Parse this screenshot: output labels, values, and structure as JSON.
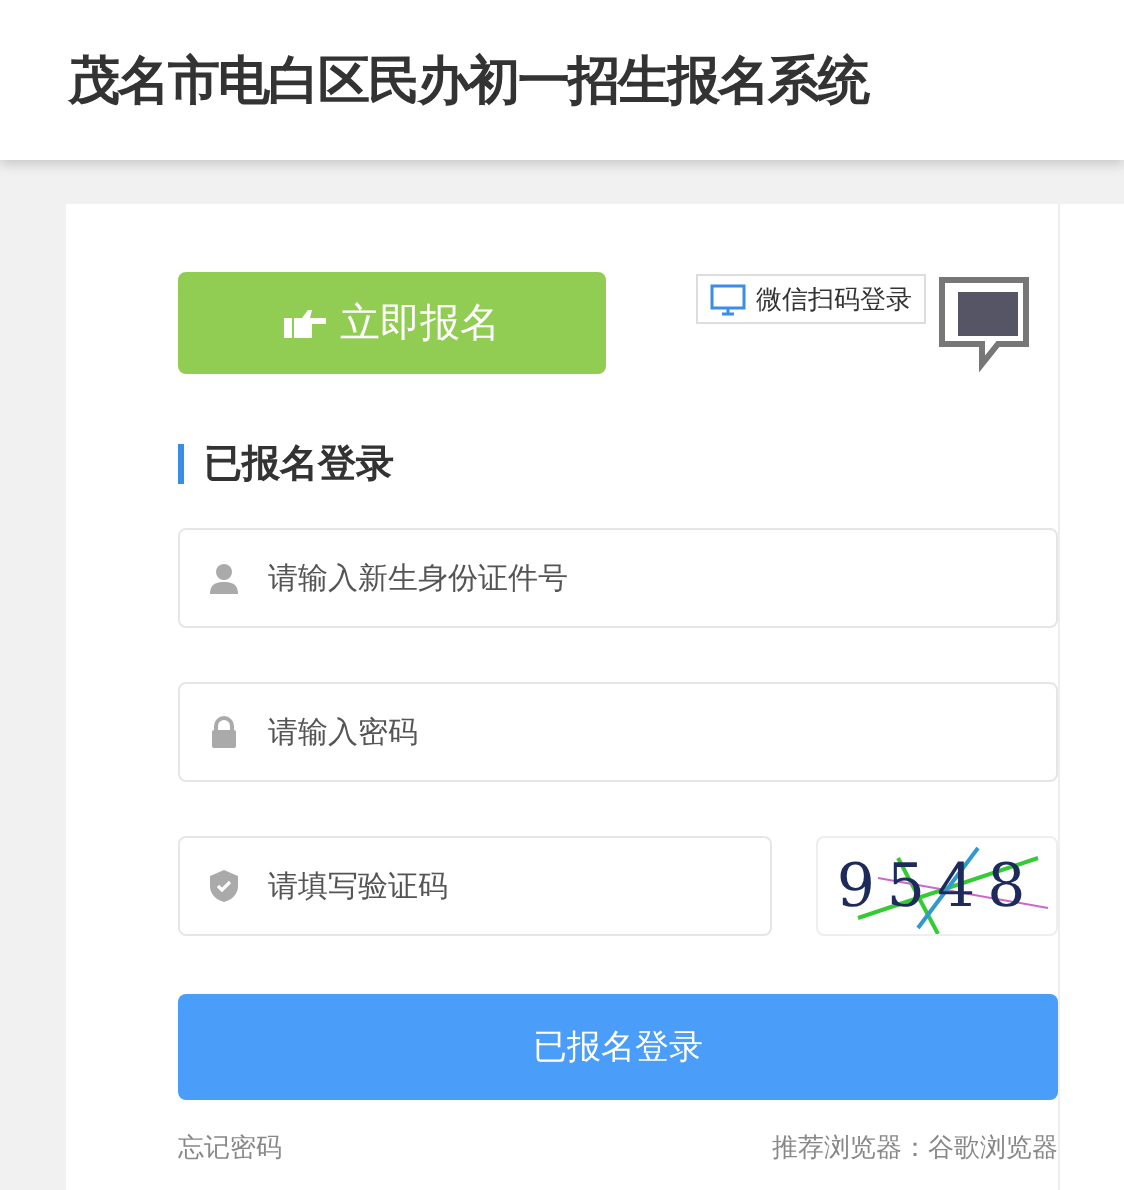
{
  "header": {
    "title": "茂名市电白区民办初一招生报名系统"
  },
  "register_button": "立即报名",
  "wechat_login": "微信扫码登录",
  "section_title": "已报名登录",
  "fields": [
    {
      "kind": "user",
      "placeholder": "请输入新生身份证件号"
    },
    {
      "kind": "lock",
      "placeholder": "请输入密码"
    },
    {
      "kind": "shield",
      "placeholder": "请填写验证码"
    }
  ],
  "captcha": "9548",
  "login_button": "已报名登录",
  "forgot_link": "忘记密码",
  "browser_note": "推荐浏览器：谷歌浏览器"
}
